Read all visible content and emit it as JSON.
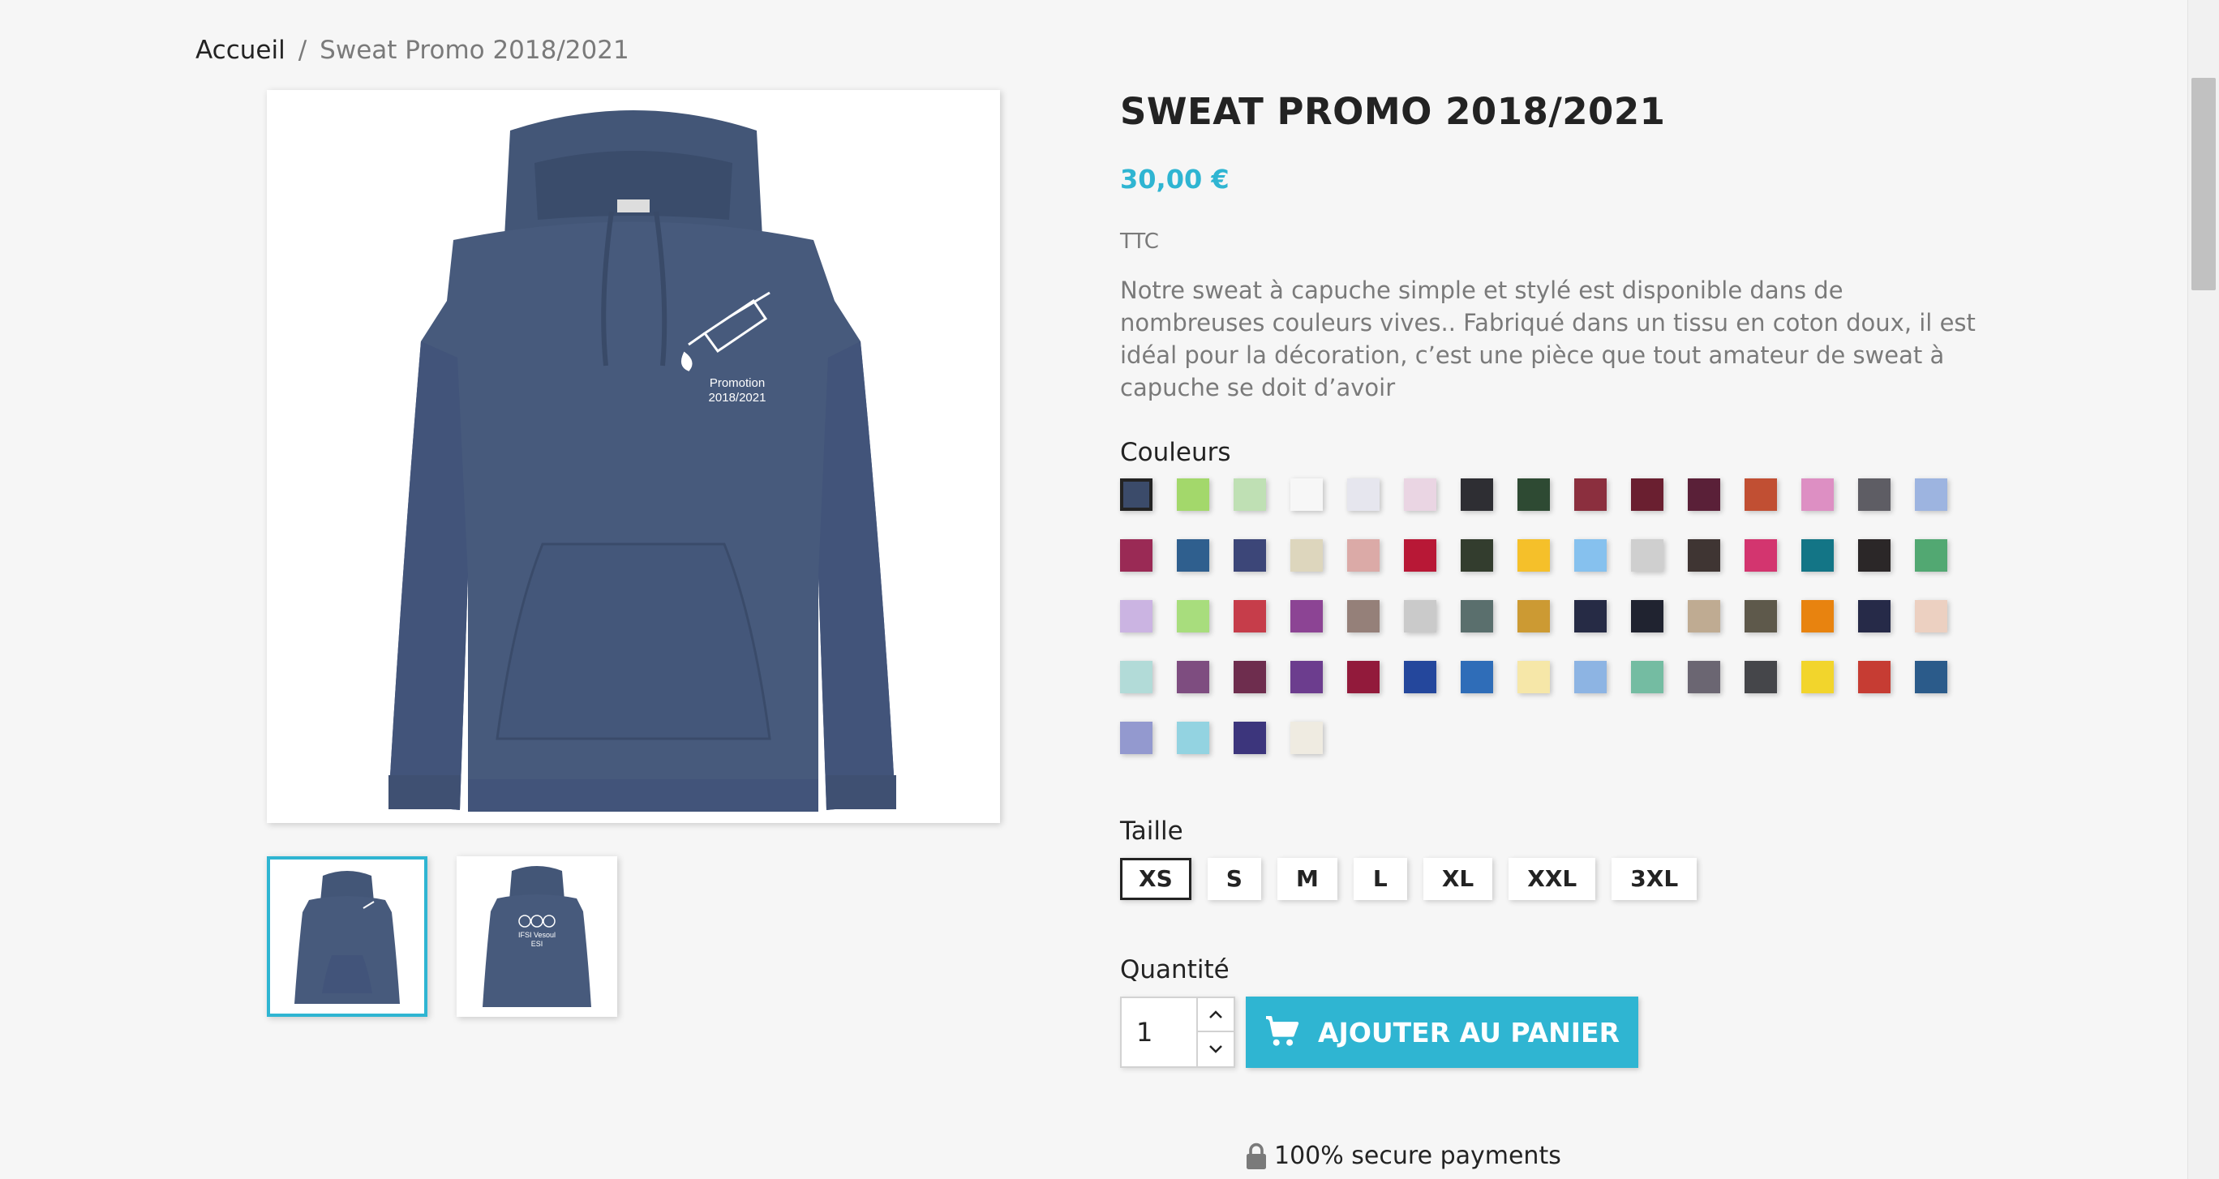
{
  "breadcrumb": {
    "home": "Accueil",
    "separator": "/",
    "current": "Sweat Promo 2018/2021"
  },
  "product": {
    "title": "SWEAT PROMO 2018/2021",
    "price": "30,00 €",
    "tax_label": "TTC",
    "description": "Notre sweat à capuche simple et stylé est disponible dans de nombreuses couleurs vives.. Fabriqué dans un tissu en coton doux, il est idéal pour la décoration, c’est une pièce que tout amateur de sweat à capuche se doit d’avoir",
    "image_print": {
      "line1": "Promotion",
      "line2": "2018/2021"
    },
    "thumb_back_print": {
      "line1": "IFSI Vesoul",
      "line2": "ESI"
    }
  },
  "colors": {
    "label": "Couleurs",
    "selected_index": 0,
    "swatches": [
      "#3b4b6a",
      "#a3d86b",
      "#bfe0b4",
      "#f7f7f7",
      "#e6e6ee",
      "#ead5e3",
      "#2e2e33",
      "#2e4a33",
      "#8b2f3e",
      "#6a1f30",
      "#5a2038",
      "#c14f33",
      "#dd8fc3",
      "#5e5d64",
      "#9db4e0",
      "#9a2a55",
      "#2f5f8e",
      "#3c4678",
      "#ddd6bd",
      "#dbaaa7",
      "#b81836",
      "#333d2e",
      "#f5c02a",
      "#86c1ee",
      "#cfcfcf",
      "#3f3533",
      "#d3356f",
      "#137586",
      "#2b2728",
      "#52a872",
      "#cbb4e2",
      "#a8dd7d",
      "#c63d4a",
      "#8c4494",
      "#958079",
      "#cacaca",
      "#5a6f6d",
      "#cc9a33",
      "#262b45",
      "#202330",
      "#bfab92",
      "#5e594b",
      "#e8830f",
      "#262a48",
      "#ecd0c1",
      "#b2dbd8",
      "#7e4d80",
      "#6e2d4e",
      "#6c3d8e",
      "#921a3b",
      "#24479c",
      "#2f6db8",
      "#f6e7a8",
      "#8db4e3",
      "#74bca2",
      "#6b6672",
      "#45464a",
      "#f2d52c",
      "#c63c33",
      "#2b5b8a",
      "#9399cf",
      "#93d3e1",
      "#3c357c",
      "#efebe1"
    ]
  },
  "sizes": {
    "label": "Taille",
    "selected": "XS",
    "options": [
      "XS",
      "S",
      "M",
      "L",
      "XL",
      "XXL",
      "3XL"
    ]
  },
  "quantity": {
    "label": "Quantité",
    "value": "1"
  },
  "cart": {
    "add_label": "AJOUTER AU PANIER"
  },
  "secure": {
    "text": "100% secure payments"
  },
  "theme": {
    "accent": "#2fb5d2",
    "hoodie": "#475a7c",
    "text": "#232323",
    "muted": "#7a7a7a"
  }
}
